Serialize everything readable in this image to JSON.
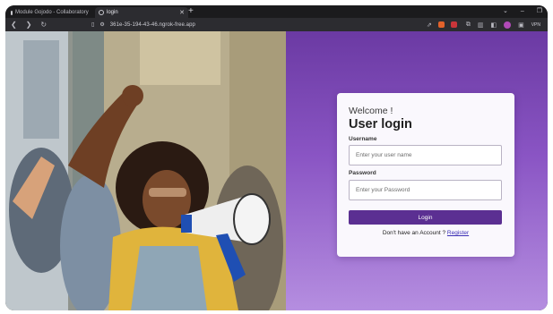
{
  "browser": {
    "tabs": [
      {
        "label": "Module Gojodo - Collaboratory",
        "icon": "colab-icon"
      },
      {
        "label": "login",
        "icon": "globe-icon",
        "active": true
      }
    ],
    "new_tab": "+",
    "url": "361e-35-194-43-46.ngrok-free.app",
    "vpn_label": "VPN"
  },
  "login": {
    "welcome": "Welcome !",
    "title": "User login",
    "username_label": "Username",
    "username_placeholder": "Enter your user name",
    "password_label": "Password",
    "password_placeholder": "Enter your Password",
    "submit_label": "Login",
    "register_prompt": "Don't have an Account ?",
    "register_link": "Register"
  },
  "colors": {
    "panel_gradient_top": "#6b3aa3",
    "panel_gradient_bottom": "#b58ee0",
    "button": "#5b2f92",
    "link": "#3b2fb5"
  }
}
